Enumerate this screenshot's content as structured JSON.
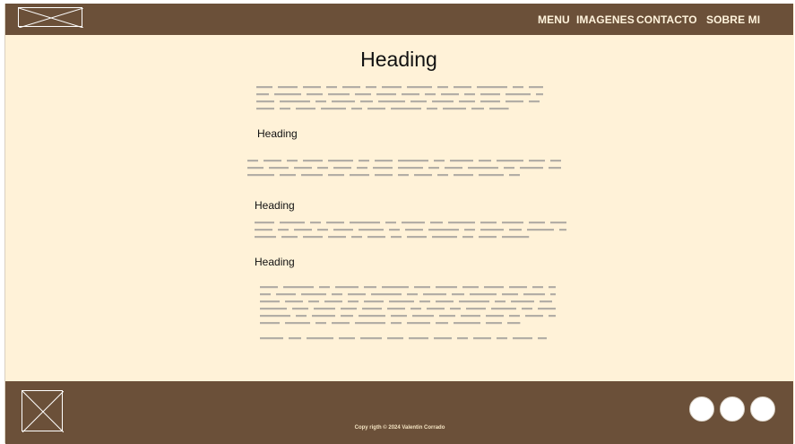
{
  "header": {
    "logo_icon": "image-placeholder-icon",
    "nav": [
      {
        "label": "MENU"
      },
      {
        "label": "IMAGENES"
      },
      {
        "label": "CONTACTO"
      },
      {
        "label": "SOBRE MI"
      }
    ]
  },
  "main": {
    "heading": "Heading",
    "sections": [
      {
        "heading": "Heading"
      },
      {
        "heading": "Heading"
      },
      {
        "heading": "Heading"
      }
    ]
  },
  "footer": {
    "logo_icon": "image-placeholder-icon",
    "copyright": "Copy rigth © 2024 Valentin Corrado",
    "social_icons": [
      "social-circle-icon",
      "social-circle-icon",
      "social-circle-icon"
    ]
  },
  "colors": {
    "header_bg": "#6b5039",
    "page_bg": "#fff2d8",
    "nav_text": "#fff3dc",
    "placeholder_lines": "#b3aea6"
  }
}
